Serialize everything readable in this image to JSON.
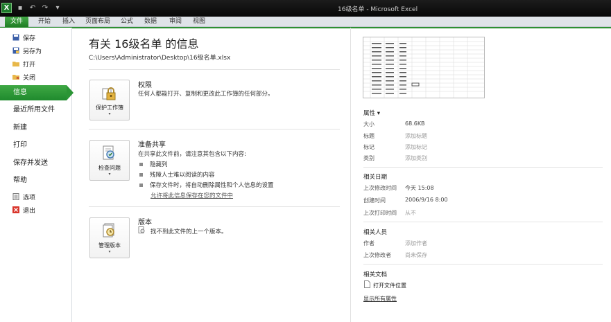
{
  "window": {
    "title": "16级名单 - Microsoft Excel"
  },
  "tabs": {
    "file": "文件",
    "items": [
      "开始",
      "插入",
      "页面布局",
      "公式",
      "数据",
      "审阅",
      "视图"
    ]
  },
  "nav": {
    "save": "保存",
    "save_as": "另存为",
    "open": "打开",
    "close": "关闭",
    "info": "信息",
    "recent": "最近所用文件",
    "new": "新建",
    "print": "打印",
    "save_send": "保存并发送",
    "help": "帮助",
    "options": "选项",
    "exit": "退出"
  },
  "info": {
    "title": "有关 16级名单 的信息",
    "path": "C:\\Users\\Administrator\\Desktop\\16级名单.xlsx"
  },
  "permissions": {
    "button": "保护工作簿",
    "title": "权限",
    "text": "任何人都能打开、复制和更改此工作簿的任何部分。"
  },
  "share": {
    "button": "检查问题",
    "title": "准备共享",
    "text": "在共享此文件前，请注意其包含以下内容:",
    "bullets": [
      "隐藏列",
      "残障人士难以阅读的内容",
      "保存文件时，将自动删除属性和个人信息的设置"
    ],
    "link": "允许将此信息保存在您的文件中"
  },
  "versions": {
    "button": "管理版本",
    "title": "版本",
    "text": "找不到此文件的上一个版本。"
  },
  "properties": {
    "header": "属性 ▾",
    "rows": [
      {
        "label": "大小",
        "value": "68.6KB"
      },
      {
        "label": "标题",
        "value": "添加标题"
      },
      {
        "label": "标记",
        "value": "添加标记"
      },
      {
        "label": "类别",
        "value": "添加类别"
      }
    ]
  },
  "dates": {
    "header": "相关日期",
    "rows": [
      {
        "label": "上次修改时间",
        "value": "今天 15:08"
      },
      {
        "label": "创建时间",
        "value": "2006/9/16 8:00"
      },
      {
        "label": "上次打印时间",
        "value": "从不"
      }
    ]
  },
  "people": {
    "header": "相关人员",
    "rows": [
      {
        "label": "作者",
        "value": "添加作者"
      },
      {
        "label": "上次修改者",
        "value": "尚未保存"
      }
    ]
  },
  "docs": {
    "header": "相关文档",
    "open_location": "打开文件位置",
    "show_all": "显示所有属性"
  }
}
